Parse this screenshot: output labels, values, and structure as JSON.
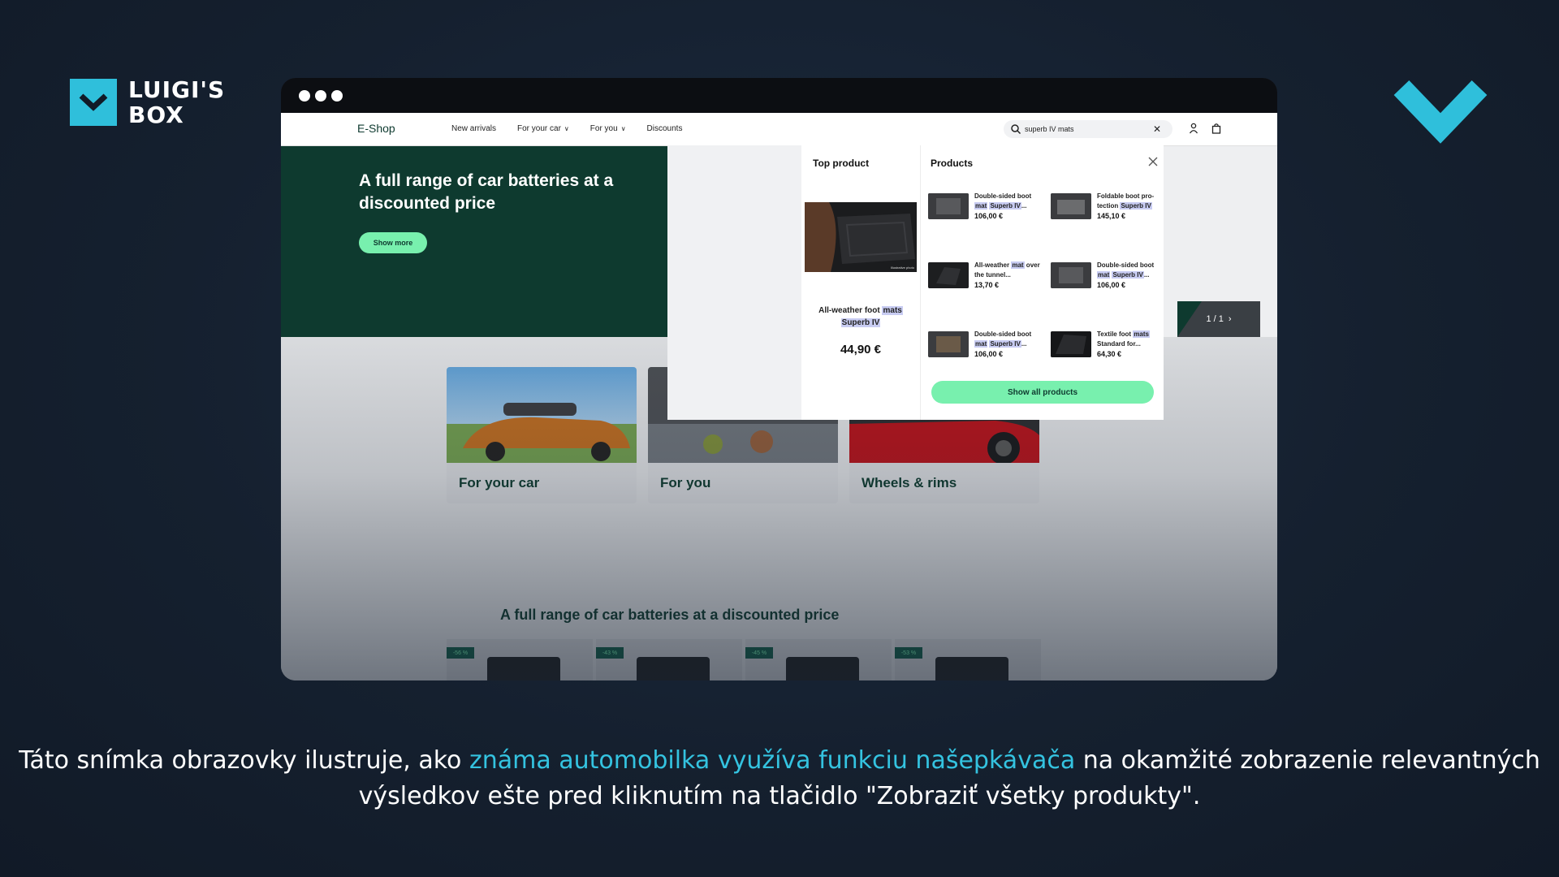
{
  "logo": {
    "line1": "LUIGI'S",
    "line2": "BOX"
  },
  "colors": {
    "accent": "#2fbfdb",
    "brand_green": "#0e3a2f",
    "button_green": "#78f0ae",
    "highlight": "#c8ccf2"
  },
  "navbar": {
    "brand": "E-Shop",
    "links": [
      "New arrivals",
      "For your car",
      "For you",
      "Discounts"
    ],
    "search_value": "superb IV mats",
    "icons": [
      "search-icon",
      "close-icon",
      "user-icon",
      "cart-icon"
    ]
  },
  "hero": {
    "title": "A full range of car batteries at a discounted price",
    "button": "Show more",
    "pager": "1 / 1"
  },
  "categories": [
    "For your car",
    "For you",
    "Wheels & rims"
  ],
  "section_title": "A full range of car batteries at a discounted price",
  "battery_discounts": [
    "-56 %",
    "-43 %",
    "-45 %",
    "-53 %"
  ],
  "dropdown": {
    "top_heading": "Top product",
    "top_product": {
      "name_pre": "All-weather foot ",
      "name_hl1": "mats",
      "name_hl2": "Superb IV",
      "price": "44,90 €",
      "badge": "Illustrative photo"
    },
    "products_heading": "Products",
    "products": [
      {
        "pre": "Double-sided boot ",
        "hl": "mat",
        "mid": " ",
        "hl2": "Superb IV",
        "post": "...",
        "price": "106,00 €"
      },
      {
        "pre": "Foldable boot pro-tection ",
        "hl": "Superb IV",
        "mid": "",
        "hl2": "",
        "post": "",
        "price": "145,10 €"
      },
      {
        "pre": "All-weather ",
        "hl": "mat",
        "mid": " over the tunnel...",
        "hl2": "",
        "post": "",
        "price": "13,70 €"
      },
      {
        "pre": "Double-sided boot ",
        "hl": "mat",
        "mid": " ",
        "hl2": "Superb IV",
        "post": "...",
        "price": "106,00 €"
      },
      {
        "pre": "Double-sided boot ",
        "hl": "mat",
        "mid": " ",
        "hl2": "Superb IV",
        "post": "...",
        "price": "106,00 €"
      },
      {
        "pre": "Textile foot ",
        "hl": "mats",
        "mid": " Standard for...",
        "hl2": "",
        "post": "",
        "price": "64,30 €"
      }
    ],
    "show_all": "Show all products"
  },
  "caption": {
    "pre": "Táto snímka obrazovky ilustruje, ako ",
    "highlight": "známa automobilka využíva funkciu našepkávača",
    "post": " na okamžité zobrazenie relevantných výsledkov ešte pred kliknutím na tlačidlo \"Zobraziť všetky produkty\"."
  }
}
